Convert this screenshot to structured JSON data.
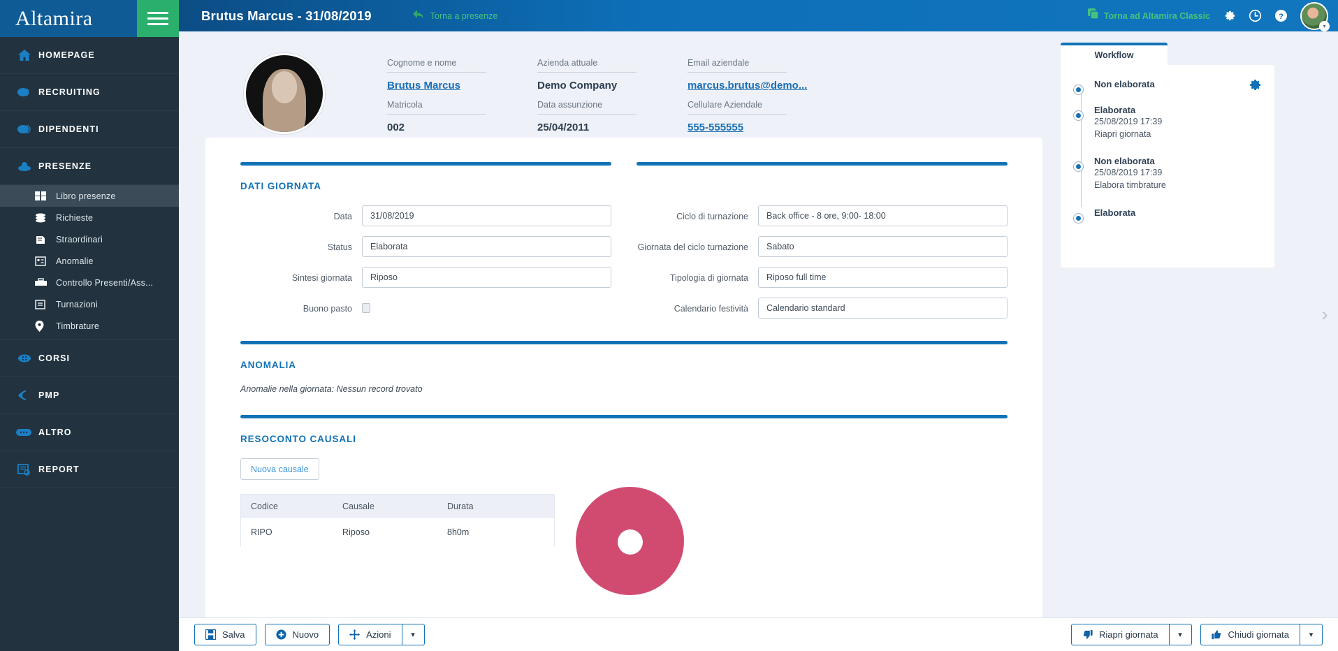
{
  "brand": {
    "logo": "Altamira",
    "menu_icon": "hamburger-icon"
  },
  "topbar": {
    "title": "Brutus Marcus - 31/08/2019",
    "back_label": "Torna a presenze",
    "classic_label": "Torna ad Altamira Classic",
    "icons": [
      "gear-icon",
      "clock-icon",
      "help-icon"
    ]
  },
  "sidebar": {
    "items": [
      {
        "label": "HOMEPAGE",
        "icon": "home-icon"
      },
      {
        "label": "RECRUITING",
        "icon": "recruiting-icon"
      },
      {
        "label": "DIPENDENTI",
        "icon": "employees-icon"
      },
      {
        "label": "PRESENZE",
        "icon": "attendance-icon",
        "active": true
      },
      {
        "label": "CORSI",
        "icon": "courses-icon"
      },
      {
        "label": "PMP",
        "icon": "pmp-icon"
      },
      {
        "label": "ALTRO",
        "icon": "other-icon"
      },
      {
        "label": "REPORT",
        "icon": "report-icon"
      }
    ],
    "subitems": [
      {
        "label": "Libro presenze",
        "icon": "grid-icon",
        "selected": true
      },
      {
        "label": "Richieste",
        "icon": "database-icon"
      },
      {
        "label": "Straordinari",
        "icon": "overtime-icon"
      },
      {
        "label": "Anomalie",
        "icon": "anomaly-icon"
      },
      {
        "label": "Controllo Presenti/Ass...",
        "icon": "briefcase-icon"
      },
      {
        "label": "Turnazioni",
        "icon": "clipboard-icon"
      },
      {
        "label": "Timbrature",
        "icon": "pin-icon"
      }
    ]
  },
  "profile": {
    "fields": [
      {
        "label": "Cognome e nome",
        "value": "Brutus Marcus",
        "link": true
      },
      {
        "label": "Azienda attuale",
        "value": "Demo Company",
        "link": false
      },
      {
        "label": "Email aziendale",
        "value": "marcus.brutus@demo...",
        "link": true
      },
      {
        "label": "Matricola",
        "value": "002",
        "link": false
      },
      {
        "label": "Data assunzione",
        "value": "25/04/2011",
        "link": false
      },
      {
        "label": "Cellulare Aziendale",
        "value": "555-555555",
        "link": true
      }
    ]
  },
  "dati_giornata": {
    "title": "DATI GIORNATA",
    "left_fields": [
      {
        "label": "Data",
        "value": "31/08/2019",
        "type": "text"
      },
      {
        "label": "Status",
        "value": "Elaborata",
        "type": "text"
      },
      {
        "label": "Sintesi giornata",
        "value": "Riposo",
        "type": "text"
      },
      {
        "label": "Buono pasto",
        "value": "",
        "type": "checkbox"
      }
    ],
    "right_fields": [
      {
        "label": "Ciclo di turnazione",
        "value": "Back office - 8 ore, 9:00- 18:00",
        "type": "text"
      },
      {
        "label": "Giornata del ciclo turnazione",
        "value": "Sabato",
        "type": "text"
      },
      {
        "label": "Tipologia di giornata",
        "value": "Riposo full time",
        "type": "text"
      },
      {
        "label": "Calendario festività",
        "value": "Calendario standard",
        "type": "text"
      }
    ]
  },
  "anomalia": {
    "title": "ANOMALIA",
    "note": "Anomalie nella giornata: Nessun record trovato"
  },
  "resoconto": {
    "title": "RESOCONTO CAUSALI",
    "new_button": "Nuova causale",
    "columns": [
      "Codice",
      "Causale",
      "Durata"
    ],
    "rows": [
      {
        "codice": "RIPO",
        "causale": "Riposo",
        "durata": "8h0m"
      }
    ]
  },
  "workflow": {
    "tab_label": "Workflow",
    "gear_icon": "gear-icon",
    "steps": [
      {
        "name": "Non elaborata",
        "date": "",
        "action": ""
      },
      {
        "name": "Elaborata",
        "date": "25/08/2019 17:39",
        "action": "Riapri giornata"
      },
      {
        "name": "Non elaborata",
        "date": "25/08/2019 17:39",
        "action": "Elabora timbrature"
      },
      {
        "name": "Elaborata",
        "date": "",
        "action": ""
      }
    ]
  },
  "bottombar": {
    "save": "Salva",
    "new": "Nuovo",
    "actions": "Azioni",
    "reopen": "Riapri giornata",
    "close": "Chiudi giornata"
  },
  "colors": {
    "brand_blue": "#0f5b96",
    "accent_blue": "#1272b6",
    "green": "#2ab06c",
    "sidebar_bg": "#22333f",
    "pink": "#d14b71"
  }
}
